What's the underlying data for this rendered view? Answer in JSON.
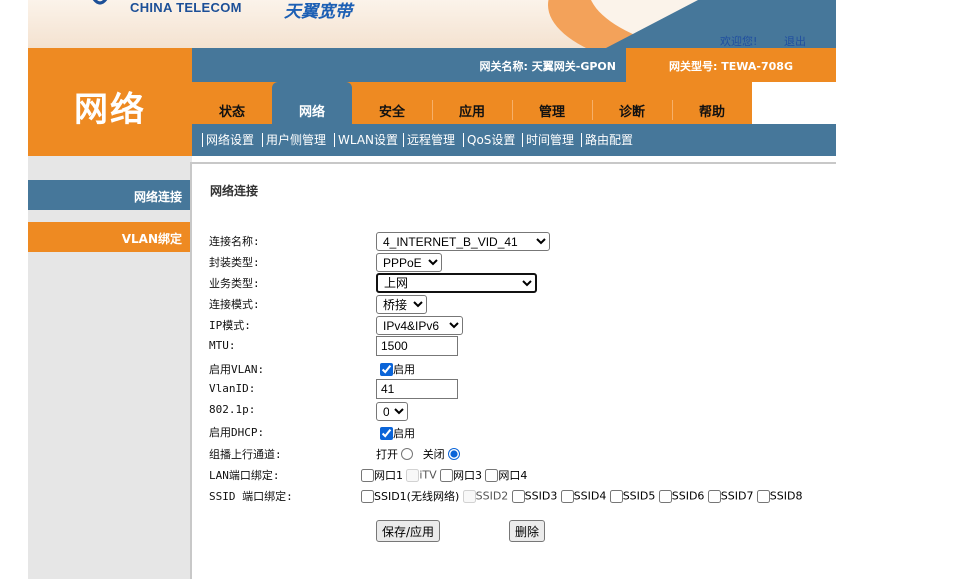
{
  "header": {
    "brand_en": "CHINA TELECOM",
    "brand_cn": "天翼宽带",
    "welcome": "欢迎您!",
    "logout": "退出",
    "gateway_name": "网关名称:  天翼网关-GPON",
    "gateway_model": "网关型号: TEWA-708G",
    "section_title": "网络"
  },
  "tabs": [
    {
      "label": "状态",
      "active": false
    },
    {
      "label": "网络",
      "active": true
    },
    {
      "label": "安全",
      "active": false
    },
    {
      "label": "应用",
      "active": false
    },
    {
      "label": "管理",
      "active": false
    },
    {
      "label": "诊断",
      "active": false
    },
    {
      "label": "帮助",
      "active": false
    }
  ],
  "submenu": [
    "网络设置",
    "用户侧管理",
    "WLAN设置",
    "远程管理",
    "QoS设置",
    "时间管理",
    "路由配置"
  ],
  "sidebar": {
    "items": [
      {
        "label": "网络连接"
      },
      {
        "label": "VLAN绑定"
      }
    ]
  },
  "content": {
    "title": "网络连接",
    "labels": {
      "conn_name": "连接名称:",
      "encap": "封装类型:",
      "service": "业务类型:",
      "conn_mode": "连接模式:",
      "ip_mode": "IP模式:",
      "mtu": "MTU:",
      "vlan_enable": "启用VLAN:",
      "vlan_id": "VlanID:",
      "dot1p": "802.1p:",
      "dhcp_enable": "启用DHCP:",
      "multicast": "组播上行通道:",
      "lan_bind": "LAN端口绑定:",
      "ssid_bind": "SSID 端口绑定:"
    },
    "values": {
      "conn_name": "4_INTERNET_B_VID_41",
      "encap": "PPPoE",
      "service": "上网",
      "conn_mode": "桥接",
      "ip_mode": "IPv4&IPv6",
      "mtu": "1500",
      "vlan_id": "41",
      "dot1p": "0"
    },
    "vlan_enable": {
      "text": "启用",
      "checked": true
    },
    "dhcp_enable": {
      "text": "启用",
      "checked": true
    },
    "multicast": {
      "open": "打开",
      "close": "关闭",
      "selected": "close"
    },
    "lan_ports": [
      {
        "label": "网口1",
        "checked": false,
        "disabled": false
      },
      {
        "label": "iTV",
        "checked": false,
        "disabled": true
      },
      {
        "label": "网口3",
        "checked": false,
        "disabled": false
      },
      {
        "label": "网口4",
        "checked": false,
        "disabled": false
      }
    ],
    "ssid_ports": [
      {
        "label": "SSID1(无线网络)",
        "checked": false,
        "disabled": false
      },
      {
        "label": "SSID2",
        "checked": false,
        "disabled": true
      },
      {
        "label": "SSID3",
        "checked": false,
        "disabled": false
      },
      {
        "label": "SSID4",
        "checked": false,
        "disabled": false
      },
      {
        "label": "SSID5",
        "checked": false,
        "disabled": false
      },
      {
        "label": "SSID6",
        "checked": false,
        "disabled": false
      },
      {
        "label": "SSID7",
        "checked": false,
        "disabled": false
      },
      {
        "label": "SSID8",
        "checked": false,
        "disabled": false
      }
    ],
    "buttons": {
      "save": "保存/应用",
      "delete": "删除"
    }
  },
  "colors": {
    "orange": "#ee8a22",
    "blue": "#46779a",
    "link_blue": "#1f4ea0"
  }
}
